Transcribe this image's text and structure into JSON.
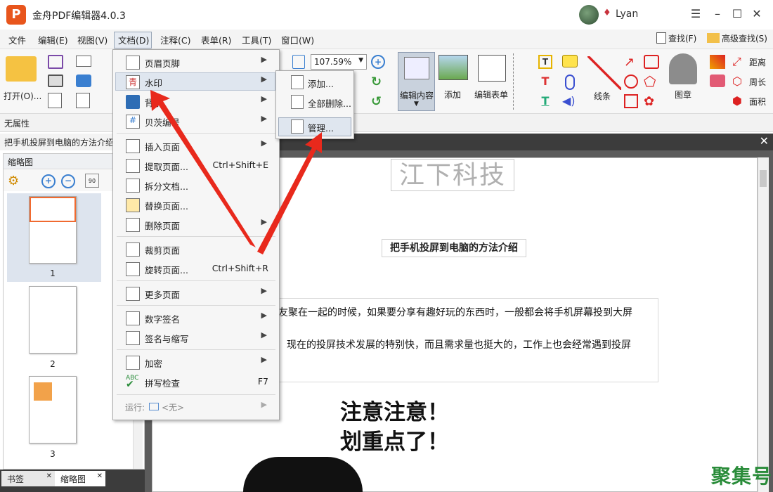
{
  "window": {
    "title": "金舟PDF编辑器4.0.3",
    "logo": "P",
    "user": "Lyan"
  },
  "menubar": {
    "items": [
      "文件",
      "编辑(E)",
      "视图(V)",
      "文档(D)",
      "注释(C)",
      "表单(R)",
      "工具(T)",
      "窗口(W)"
    ],
    "find": "查找(F)",
    "adv_find": "高级查找(S)"
  },
  "toolbar": {
    "open": "打开(O)...",
    "zoom": "107.59%",
    "edit_content": "编辑内容",
    "add": "添加",
    "edit_form": "编辑表单",
    "line": "线条",
    "stamp": "图章",
    "distance": "距离",
    "perimeter": "周长",
    "area": "面积"
  },
  "props": {
    "label": "无属性"
  },
  "doc_tab": {
    "title": "把手机投屏到电脑的方法介绍"
  },
  "thumbnails": {
    "title": "缩略图",
    "pages": [
      "1",
      "2",
      "3"
    ]
  },
  "bottom_tabs": {
    "bookmark": "书签",
    "thumbs": "缩略图"
  },
  "document_menu": {
    "items": [
      {
        "label": "页眉页脚",
        "shortcut": ""
      },
      {
        "label": "水印",
        "shortcut": ""
      },
      {
        "label": "背景",
        "shortcut": ""
      },
      {
        "label": "贝茨编号",
        "shortcut": ""
      },
      {
        "label": "插入页面",
        "shortcut": ""
      },
      {
        "label": "提取页面...",
        "shortcut": "Ctrl+Shift+E"
      },
      {
        "label": "拆分文档...",
        "shortcut": ""
      },
      {
        "label": "替换页面...",
        "shortcut": ""
      },
      {
        "label": "删除页面",
        "shortcut": ""
      },
      {
        "label": "裁剪页面",
        "shortcut": ""
      },
      {
        "label": "旋转页面...",
        "shortcut": "Ctrl+Shift+R"
      },
      {
        "label": "更多页面",
        "shortcut": ""
      },
      {
        "label": "数字签名",
        "shortcut": ""
      },
      {
        "label": "签名与缩写",
        "shortcut": ""
      },
      {
        "label": "加密",
        "shortcut": ""
      },
      {
        "label": "拼写检查",
        "shortcut": "F7"
      }
    ],
    "run_label": "运行:",
    "run_value": "<无>"
  },
  "watermark_submenu": {
    "add": "添加...",
    "delete_all": "全部删除...",
    "manage": "管理..."
  },
  "page": {
    "watermark_text": "江下科技",
    "heading": "把手机投屏到电脑的方法介绍",
    "para1": "友聚在一起的时候，如果要分享有趣好玩的东西时，一般都会将手机屏幕投到大屏",
    "para2": "现在的投屏技术发展的特别快，而且需求量也挺大的，工作上也会经常遇到投屏",
    "meme_line1": "注意注意！",
    "meme_line2": "划重点了！"
  },
  "corner_mark": "聚集号",
  "colors": {
    "accent": "#e8551c",
    "arrow": "#e8291c",
    "menu_highlight": "#dfe6ef"
  }
}
